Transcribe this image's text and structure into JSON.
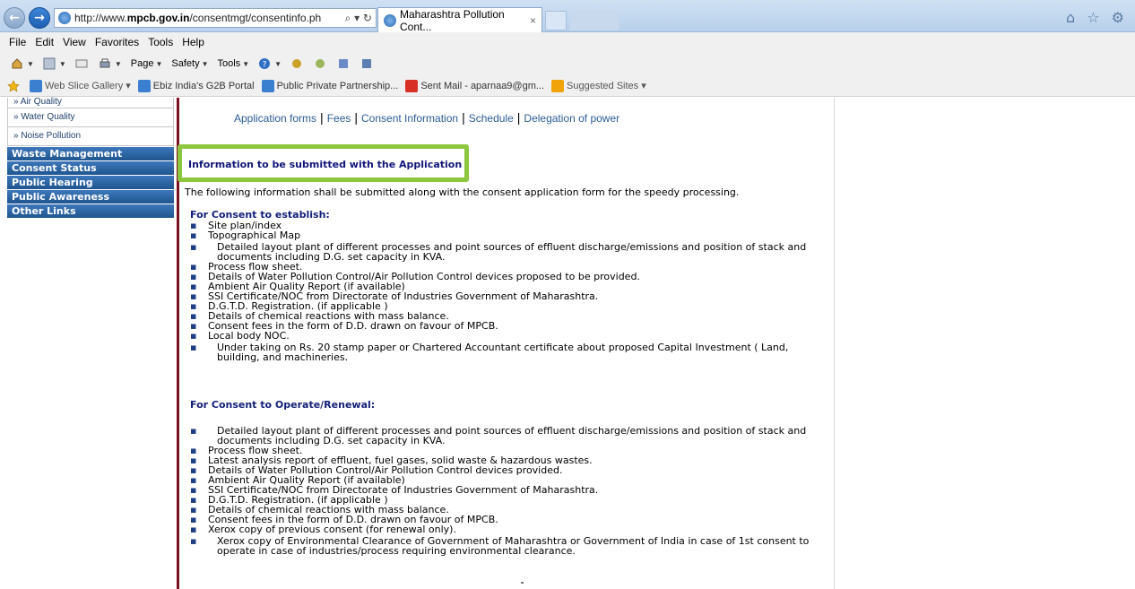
{
  "browser": {
    "url_plain_prefix": "http://www.",
    "url_domain": "mpcb.gov.in",
    "url_path": "/consentmgt/consentinfo.ph",
    "addr_tools": "⌕ ▾ ↻",
    "tab_title": "Maharashtra Pollution Cont...",
    "tab_close": "×",
    "title_icons": "⌂ ☆ ⚙"
  },
  "menu": [
    "File",
    "Edit",
    "View",
    "Favorites",
    "Tools",
    "Help"
  ],
  "commandbar": {
    "page": "Page",
    "safety": "Safety",
    "tools": "Tools"
  },
  "favorites": [
    {
      "label": "Web Slice Gallery ▾",
      "icon_color": "#3a7fd0"
    },
    {
      "label": "Ebiz India's G2B Portal",
      "icon_color": "#3a7fd0"
    },
    {
      "label": "Public Private Partnership...",
      "icon_color": "#3a7fd0"
    },
    {
      "label": "Sent Mail - aparnaa9@gm...",
      "icon_color": "#d93025"
    },
    {
      "label": "Suggested Sites ▾",
      "icon_color": "#f0a30a"
    }
  ],
  "sidebar": {
    "sublinks": [
      "» Air Quality",
      "» Water Quality",
      "» Noise Pollution"
    ],
    "mainlinks": [
      "Waste Management",
      "Consent Status",
      "Public Hearing",
      "Public Awareness",
      "Other Links"
    ]
  },
  "topnav": [
    "Application forms",
    "Fees",
    "Consent Information",
    "Schedule",
    "Delegation of power"
  ],
  "heading": "Information to be submitted with the Application",
  "intro": "The following information shall be submitted along with the consent application form for the speedy processing.",
  "establish": {
    "title": "For Consent to establish:",
    "items": [
      {
        "text": "Site plan/index"
      },
      {
        "text": "Topographical Map"
      },
      {
        "text": "Detailed layout plant of different processes and point sources of effluent discharge/emissions and position of stack and",
        "text2": "documents including D.G. set capacity in KVA."
      },
      {
        "text": "Process flow sheet."
      },
      {
        "text": "Details of Water Pollution Control/Air Pollution Control devices proposed to be provided."
      },
      {
        "text": "Ambient Air Quality Report (if available)"
      },
      {
        "text": "SSI Certificate/NOC from Directorate of Industries Government of Maharashtra."
      },
      {
        "text": "D.G.T.D. Registration. (if applicable )"
      },
      {
        "text": "Details of chemical reactions with mass balance."
      },
      {
        "text": "Consent fees in the form of D.D. drawn on favour of MPCB."
      },
      {
        "text": "Local body NOC."
      },
      {
        "text": "Under taking on Rs. 20 stamp paper or Chartered Accountant certificate about proposed Capital Investment ( Land,",
        "text2": "building, and machineries."
      }
    ]
  },
  "operate": {
    "title": "For Consent to Operate/Renewal:",
    "items": [
      {
        "text": "Detailed layout plant of different processes and point sources of effluent discharge/emissions and position of stack and",
        "text2": "documents including D.G. set capacity in KVA."
      },
      {
        "text": "Process flow sheet."
      },
      {
        "text": "Latest analysis report of effluent, fuel gases, solid waste & hazardous wastes."
      },
      {
        "text": "Details of Water Pollution Control/Air Pollution Control devices provided."
      },
      {
        "text": "Ambient Air Quality Report (if available)"
      },
      {
        "text": "SSI Certificate/NOC from Directorate of Industries Government of Maharashtra."
      },
      {
        "text": "D.G.T.D. Registration. (if applicable )"
      },
      {
        "text": "Details of chemical reactions with mass balance."
      },
      {
        "text": "Consent fees in the form of D.D. drawn on favour of MPCB."
      },
      {
        "text": "Xerox copy of previous consent (for renewal only)."
      },
      {
        "text": "Xerox copy of Environmental Clearance of Government of Maharashtra or Government of India in case of 1st consent to",
        "text2": "operate in case of industries/process requiring environmental clearance."
      }
    ]
  },
  "colors": {
    "accent_green": "#8dc63f",
    "sidebar_blue": "#1f558f",
    "divider_maroon": "#7a0f1f",
    "heading_navy": "#11157a"
  }
}
